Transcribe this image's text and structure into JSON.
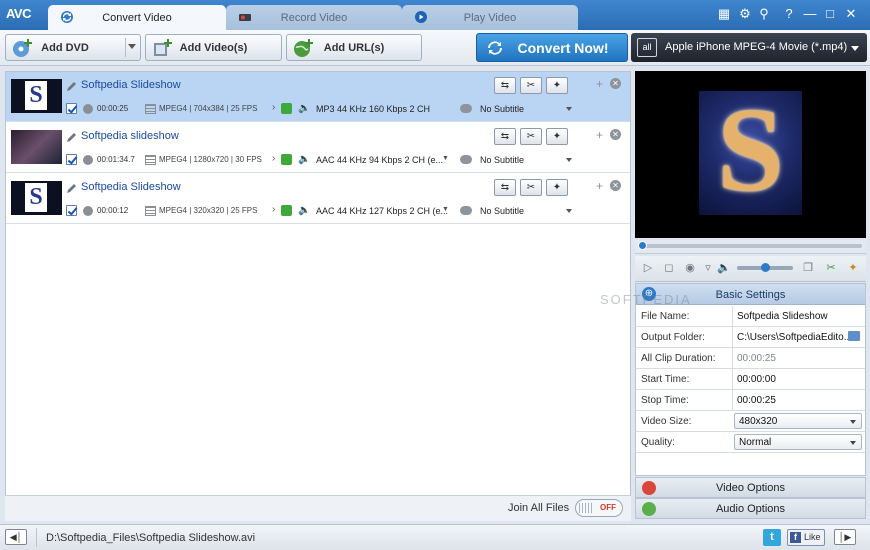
{
  "app": {
    "logo": "AVC"
  },
  "tabs": [
    {
      "label": "Convert Video",
      "active": true,
      "icon": "convert-icon"
    },
    {
      "label": "Record Video",
      "active": false,
      "icon": "record-icon"
    },
    {
      "label": "Play Video",
      "active": false,
      "icon": "play-icon"
    }
  ],
  "window_controls": [
    "menu-icon",
    "gear-icon",
    "key-icon",
    "help-icon",
    "minimize-icon",
    "maximize-icon",
    "close-icon"
  ],
  "toolbar": {
    "add_dvd": "Add DVD",
    "add_videos": "Add Video(s)",
    "add_urls": "Add URL(s)",
    "convert_now": "Convert Now!",
    "profile": "Apple iPhone MPEG-4 Movie (*.mp4)",
    "profile_badge": "all"
  },
  "files": [
    {
      "title": "Softpedia Slideshow",
      "duration": "00:00:25",
      "format": "MPEG4 | 704x384 | 25 FPS",
      "audio": "MP3 44 KHz 160 Kbps 2 CH",
      "subtitle": "No Subtitle",
      "selected": true
    },
    {
      "title": "Softpedia slideshow",
      "duration": "00:01:34.7",
      "format": "MPEG4 | 1280x720 | 30 FPS",
      "audio": "AAC 44 KHz 94 Kbps 2 CH (e...",
      "subtitle": "No Subtitle",
      "selected": false
    },
    {
      "title": "Softpedia Slideshow",
      "duration": "00:00:12",
      "format": "MPEG4 | 320x320 | 25 FPS",
      "audio": "AAC 44 KHz 127 Kbps 2 CH (e...",
      "subtitle": "No Subtitle",
      "selected": false
    }
  ],
  "join": {
    "label": "Join All Files",
    "state": "OFF"
  },
  "preview": {
    "thumb_letter": "S"
  },
  "settings": {
    "header": "Basic Settings",
    "file_name_label": "File Name:",
    "file_name": "Softpedia Slideshow",
    "output_folder_label": "Output Folder:",
    "output_folder": "C:\\Users\\SoftpediaEdito...",
    "all_clip_duration_label": "All Clip Duration:",
    "all_clip_duration": "00:00:25",
    "start_time_label": "Start Time:",
    "start_time": "00:00:00",
    "stop_time_label": "Stop Time:",
    "stop_time": "00:00:25",
    "video_size_label": "Video Size:",
    "video_size": "480x320",
    "quality_label": "Quality:",
    "quality": "Normal"
  },
  "options": {
    "video": "Video Options",
    "audio": "Audio Options"
  },
  "status": {
    "path": "D:\\Softpedia_Files\\Softpedia Slideshow.avi",
    "like": "Like",
    "twitter": "t",
    "facebook": "f"
  },
  "watermark": "SOFTPEDIA"
}
